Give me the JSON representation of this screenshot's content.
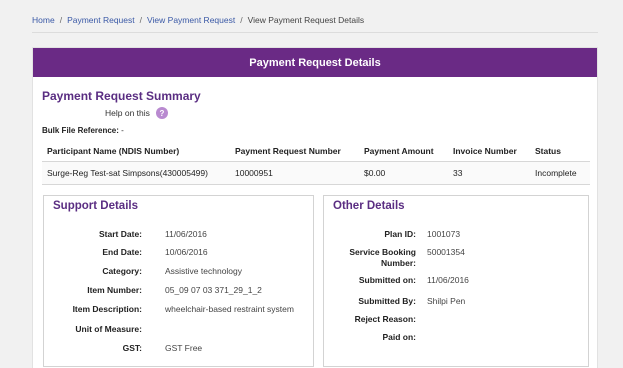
{
  "breadcrumb": {
    "items": [
      "Home",
      "Payment Request",
      "View Payment Request",
      "View Payment Request Details"
    ],
    "separator": "/"
  },
  "header": {
    "title": "Payment Request Details"
  },
  "summary": {
    "title": "Payment Request Summary",
    "help_text": "Help on this",
    "help_icon": "?",
    "bulk_label": "Bulk File Reference:",
    "bulk_value": "-",
    "columns": [
      "Participant Name (NDIS Number)",
      "Payment Request Number",
      "Payment Amount",
      "Invoice Number",
      "Status"
    ],
    "rows": [
      [
        "Surge-Reg Test-sat Simpsons(430005499)",
        "10000951",
        "$0.00",
        "33",
        "Incomplete"
      ]
    ]
  },
  "support_details": {
    "title": "Support Details",
    "fields": [
      {
        "label": "Start Date:",
        "value": "11/06/2016"
      },
      {
        "label": "End Date:",
        "value": "10/06/2016"
      },
      {
        "label": "Category:",
        "value": "Assistive technology"
      },
      {
        "label": "Item Number:",
        "value": "05_09 07 03 371_29_1_2"
      },
      {
        "label": "Item Description:",
        "value": "wheelchair-based restraint system"
      },
      {
        "label": "Unit of Measure:",
        "value": ""
      },
      {
        "label": "GST:",
        "value": "GST Free"
      }
    ]
  },
  "other_details": {
    "title": "Other Details",
    "fields": [
      {
        "label": "Plan ID:",
        "value": "1001073"
      },
      {
        "label": "Service Booking Number:",
        "value": "50001354"
      },
      {
        "label": "Submitted on:",
        "value": "11/06/2016"
      },
      {
        "label": "Submitted By:",
        "value": "Shilpi Pen"
      },
      {
        "label": "Reject Reason:",
        "value": ""
      },
      {
        "label": "Paid on:",
        "value": ""
      }
    ]
  },
  "colors": {
    "accent": "#6a2a85",
    "title_purple": "#5a2d82",
    "link_blue": "#3a59a6",
    "help_icon_bg": "#b98ad0"
  }
}
